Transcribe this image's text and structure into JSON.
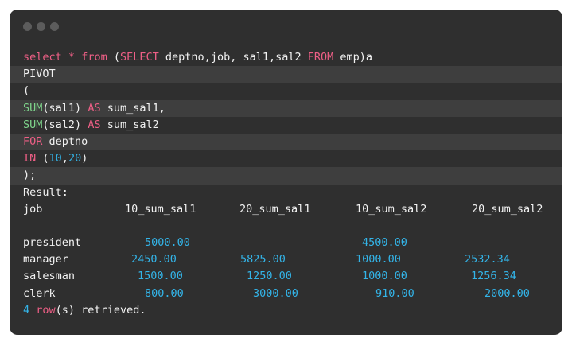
{
  "colors": {
    "background": "#2f2f2f",
    "keyword": "#ee5f86",
    "function": "#7ed48b",
    "number": "#33b4e8",
    "text": "#f2f2f2"
  },
  "query": {
    "line1": {
      "kw1": "select",
      "op": "*",
      "kw2": "from",
      "paren": "(",
      "kw3": "SELECT",
      "cols": "deptno,job, sal1,sal2",
      "kw4": "FROM",
      "tail": "emp)a"
    },
    "line2": "PIVOT",
    "line3": "(",
    "line4": {
      "fn": "SUM",
      "arg": "(sal1)",
      "kw": "AS",
      "alias": "sum_sal1,"
    },
    "line5": {
      "fn": "SUM",
      "arg": "(sal2)",
      "kw": "AS",
      "alias": "sum_sal2"
    },
    "line6": {
      "kw": "FOR",
      "col": "deptno"
    },
    "line7": {
      "kw": "IN",
      "open": "(",
      "n1": "10",
      "comma": ",",
      "n2": "20",
      "close": ")"
    },
    "line8": ");"
  },
  "result": {
    "label": "Result:",
    "headers": [
      "job",
      "10_sum_sal1",
      "20_sum_sal1",
      "10_sum_sal2",
      "20_sum_sal2"
    ],
    "rows": [
      {
        "job": "president",
        "c1": "5000.00",
        "c2": "",
        "c3": "4500.00",
        "c4": ""
      },
      {
        "job": "manager",
        "c1": "2450.00",
        "c2": "5825.00",
        "c3": "1000.00",
        "c4": "2532.34"
      },
      {
        "job": "salesman",
        "c1": "1500.00",
        "c2": "1250.00",
        "c3": "1000.00",
        "c4": "1256.34"
      },
      {
        "job": "clerk",
        "c1": "800.00",
        "c2": "3000.00",
        "c3": "910.00",
        "c4": "2000.00"
      }
    ],
    "footer": {
      "count": "4",
      "word": "row",
      "rest": "(s) retrieved."
    }
  }
}
